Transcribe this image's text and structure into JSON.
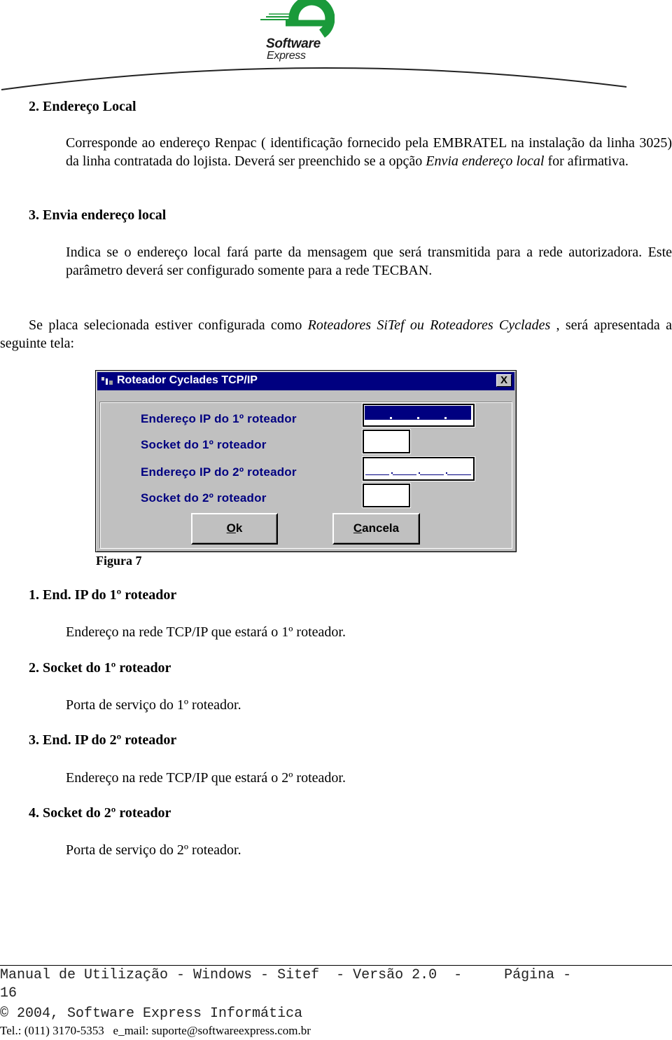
{
  "header": {
    "logo_line1": "Software",
    "logo_line2": "Express",
    "brand_color": "#1a9a3a"
  },
  "sections": [
    {
      "heading": "2. Endereço Local",
      "body_parts": [
        " Corresponde ao endereço Renpac ( identificação fornecido pela EMBRATEL na instalação da linha 3025) da linha contratada do lojista. Deverá ser preenchido se a opção ",
        "Envia endereço local",
        " for afirmativa."
      ]
    },
    {
      "heading": "3. Envia endereço local",
      "body": "Indica se o endereço local fará parte da mensagem que será transmitida para a rede autorizadora. Este parâmetro deverá ser configurado somente para a rede TECBAN."
    }
  ],
  "intro": {
    "part1": "Se placa selecionada estiver configurada como ",
    "italic": "Roteadores SiTef ou Roteadores Cyclades",
    "part2": " , será apresentada a seguinte tela:"
  },
  "dialog": {
    "title": "Roteador Cyclades TCP/IP",
    "close_label": "X",
    "title_bar_color": "#000080",
    "label_color": "#000080",
    "fields": [
      {
        "label": "Endereço IP do 1º roteador",
        "value": "",
        "mask": ". . ."
      },
      {
        "label": "Socket do 1º roteador",
        "value": ""
      },
      {
        "label": "Endereço IP do 2º roteador",
        "value": "",
        "mask": "___.___.___.___"
      },
      {
        "label": "Socket do 2º roteador",
        "value": ""
      }
    ],
    "ok_accel": "O",
    "ok_rest": "k",
    "cancel_accel": "C",
    "cancel_rest": "ancela"
  },
  "figure_caption": "Figura 7",
  "items": [
    {
      "heading": "1. End. IP do 1º roteador",
      "body": "Endereço na rede TCP/IP que estará o 1º roteador."
    },
    {
      "heading": "2. Socket do 1º roteador",
      "body": "Porta de serviço do 1º roteador."
    },
    {
      "heading": "3. End. IP do 2º roteador",
      "body": "Endereço na rede TCP/IP que estará o 2º roteador."
    },
    {
      "heading": "4. Socket do 2º roteador",
      "body": "Porta de serviço do 2º roteador."
    }
  ],
  "footer": {
    "line1": "Manual de Utilização - Windows - Sitef  - Versão 2.0  -     Página -",
    "line2": "16",
    "line3": "© 2004, Software Express Informática",
    "contact": "Tel.: (011) 3170-5353   e_mail: suporte@softwareexpress.com.br"
  }
}
